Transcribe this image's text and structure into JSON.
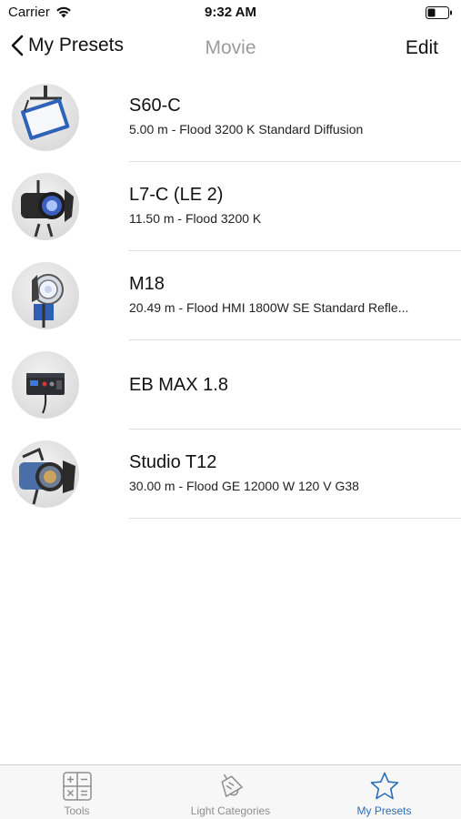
{
  "status_bar": {
    "carrier": "Carrier",
    "time": "9:32 AM"
  },
  "nav": {
    "back_label": "My Presets",
    "title": "Movie",
    "edit_label": "Edit"
  },
  "presets": [
    {
      "name": "S60-C",
      "detail": "5.00 m -  Flood 3200 K Standard Diffusion",
      "icon": "led-panel-icon"
    },
    {
      "name": "L7-C (LE 2)",
      "detail": "11.50 m -  Flood 3200 K",
      "icon": "fresnel-light-icon"
    },
    {
      "name": "M18",
      "detail": "20.49 m -  Flood HMI 1800W SE Standard Refle...",
      "icon": "hmi-light-icon"
    },
    {
      "name": "EB MAX 1.8",
      "detail": "",
      "icon": "ballast-icon"
    },
    {
      "name": "Studio T12",
      "detail": "30.00 m -  Flood GE 12000 W 120 V G38",
      "icon": "studio-fresnel-icon"
    }
  ],
  "tabs": [
    {
      "label": "Tools",
      "icon": "calculator-icon",
      "active": false
    },
    {
      "label": "Light Categories",
      "icon": "lamp-icon",
      "active": false
    },
    {
      "label": "My Presets",
      "icon": "star-icon",
      "active": true
    }
  ],
  "colors": {
    "accent": "#2a6eb5",
    "title_gray": "#9c9c9c",
    "divider": "#dedede"
  }
}
